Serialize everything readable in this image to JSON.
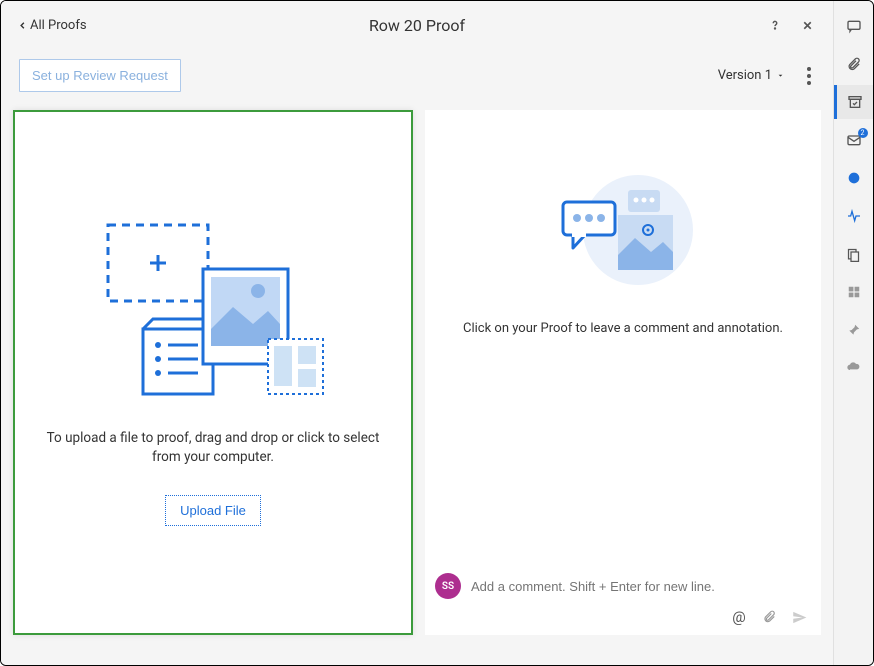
{
  "header": {
    "back_label": "All Proofs",
    "title": "Row 20 Proof"
  },
  "toolbar": {
    "setup_label": "Set up Review Request",
    "version_label": "Version 1"
  },
  "upload": {
    "text": "To upload a file to proof, drag and drop or click to select from your computer.",
    "button_label": "Upload File"
  },
  "comments": {
    "empty_text": "Click on your Proof to leave a comment and annotation.",
    "avatar_initials": "SS",
    "input_placeholder": "Add a comment. Shift + Enter for new line."
  },
  "rail": {
    "notification_badge": "2"
  }
}
